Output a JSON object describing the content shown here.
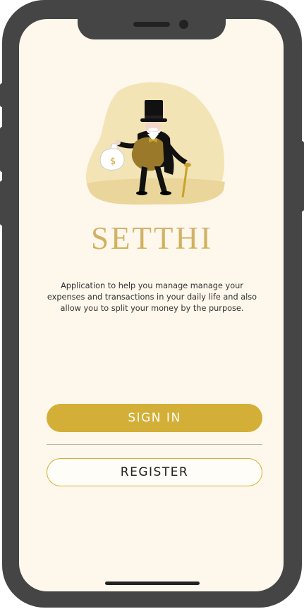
{
  "app": {
    "title": "SETTHI",
    "description": "Application to help you manage manage your expenses and transactions in your daily life and also allow you to split your money by the purpose."
  },
  "actions": {
    "sign_in_label": "SIGN IN",
    "register_label": "REGISTER"
  },
  "colors": {
    "accent": "#d4af37",
    "background": "#fdf7ec",
    "frame": "#454545"
  }
}
